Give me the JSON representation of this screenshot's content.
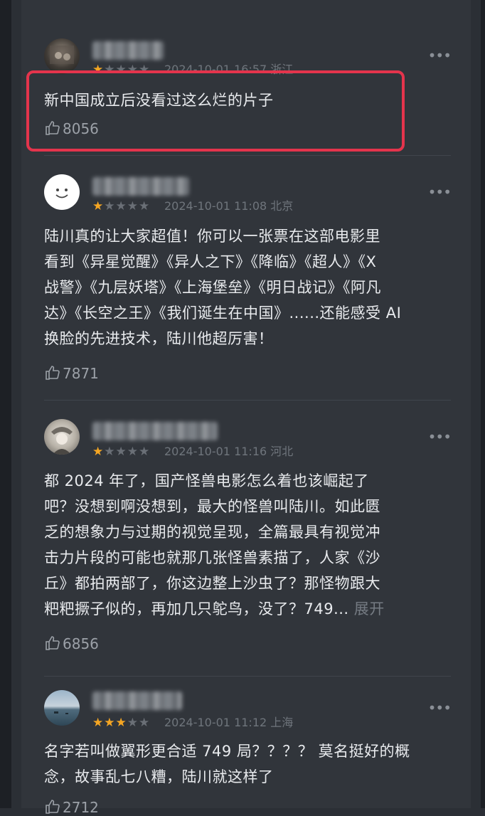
{
  "comments": [
    {
      "rating": 1,
      "meta": "2024-10-01 16:57 浙江",
      "text": "新中国成立后没看过这么烂的片子",
      "likes": "8056"
    },
    {
      "rating": 1,
      "meta": "2024-10-01 11:08 北京",
      "lines": [
        "陆川真的让大家超值！你可以一张票在这部电影里",
        "看到《异星觉醒》《异人之下》《降临》《超人》《X",
        "战警》《九层妖塔》《上海堡垒》《明日战记》《阿凡",
        "达》《长空之王》《我们诞生在中国》......还能感受 AI",
        "换脸的先进技术，陆川他超厉害！"
      ],
      "likes": "7871"
    },
    {
      "rating": 1,
      "meta": "2024-10-01 11:16 河北",
      "lines": [
        "都 2024 年了，国产怪兽电影怎么着也该崛起了",
        "吧？没想到啊没想到，最大的怪兽叫陆川。如此匮",
        "乏的想象力与过期的视觉呈现，全篇最具有视觉冲",
        "击力片段的可能也就那几张怪兽素描了，人家《沙",
        "丘》都拍两部了，你这边整上沙虫了？那怪物跟大",
        "粑粑撅子似的，再加几只鸵鸟，没了？749..."
      ],
      "expand_label": "展开",
      "likes": "6856"
    },
    {
      "rating": 3,
      "meta": "2024-10-01 11:12 上海",
      "lines": [
        "名字若叫做翼形更合适 749 局？？？？ 莫名挺好的概",
        "念，故事乱七八糟，陆川就这样了"
      ],
      "likes": "2712"
    }
  ],
  "icons": {
    "more": "more-dots-icon",
    "like": "thumbs-up-icon",
    "star": "star-icon"
  },
  "colors": {
    "background": "#31353b",
    "star": "#f5a623",
    "highlight": "#e4344c"
  }
}
